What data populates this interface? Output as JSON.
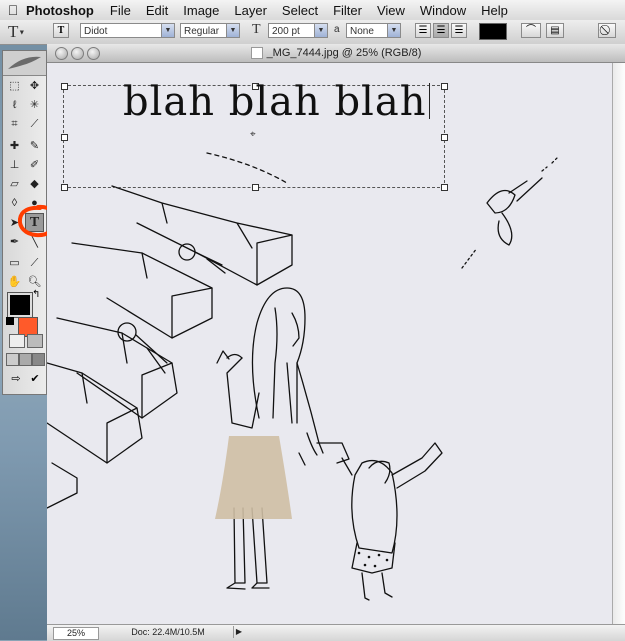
{
  "menubar": {
    "apple_icon": "apple-icon",
    "app_name": "Photoshop",
    "items": [
      "File",
      "Edit",
      "Image",
      "Layer",
      "Select",
      "Filter",
      "View",
      "Window",
      "Help"
    ]
  },
  "options_bar": {
    "tool_glyph": "T",
    "orient_glyph": "T",
    "font_family": "Didot",
    "font_style": "Regular",
    "size_glyph": "T",
    "font_size": "200 pt",
    "aa_glyph": "a",
    "antialias": "None",
    "text_color": "#000000"
  },
  "toolbox": {
    "foreground_color": "#000000",
    "background_color": "#ff5a2a",
    "annotation_color": "#ff3d00"
  },
  "document": {
    "title": "_MG_7444.jpg @ 25% (RGB/8)",
    "text_layer": "blah blah blah",
    "zoom": "25%",
    "doc_size": "Doc: 22.4M/10.5M",
    "status_arrow": "▶"
  }
}
